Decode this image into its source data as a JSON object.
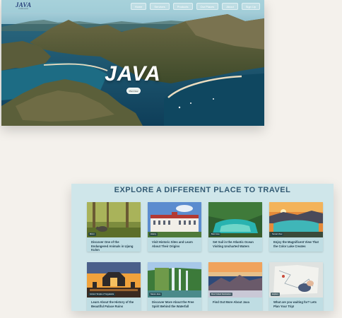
{
  "hero": {
    "logo_main": "JAVA",
    "logo_sub": "indonesia",
    "nav": [
      "Home",
      "Services",
      "Products",
      "Our Places",
      "About",
      "Sign Up"
    ],
    "title": "JAVA",
    "button": "Plan Now"
  },
  "explore": {
    "heading": "EXPLORE A DIFFERENT PLACE TO TRAVEL",
    "cards": [
      {
        "tag": "Mirror",
        "caption": "Discover One of the Endangered Animals in Ujung Kulon"
      },
      {
        "tag": "History",
        "caption": "Visit Historic Sites and Learn About Their Origins"
      },
      {
        "tag": "Best Java",
        "caption": "Set Sail in the Atlantic Ocean Visiting Uncharted Waters"
      },
      {
        "tag": "Sunset View",
        "caption": "Enjoy the Magnificent View That the Color Lake Creates"
      },
      {
        "tag": "Ancient Temple of Yogyakarta",
        "caption": "Learn About the History of the Beautiful Palace Ruins"
      },
      {
        "tag": "Nature Java",
        "caption": "Discover More About the Free Spirit Behind the Waterfall"
      },
      {
        "tag": "Most Visited Destination",
        "caption": "Find Out More About Java"
      },
      {
        "tag": "Explore",
        "caption": "What are you waiting for? Lets Plan Your Trip!"
      }
    ]
  }
}
